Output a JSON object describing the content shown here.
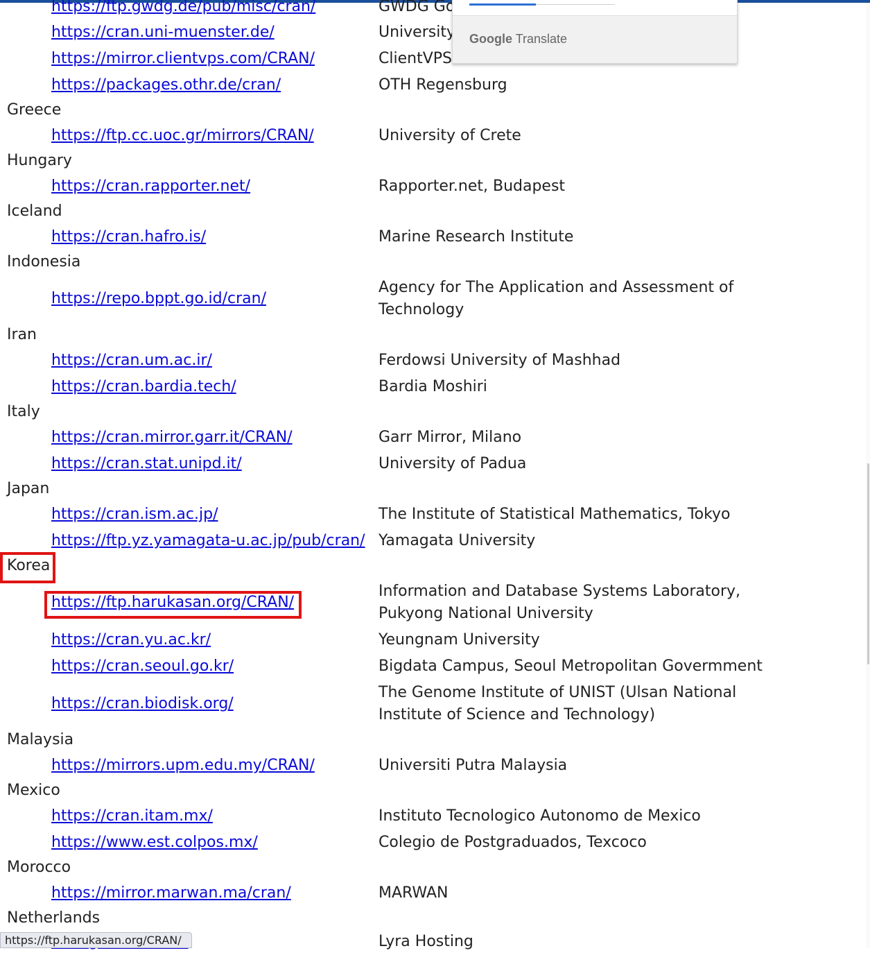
{
  "mirrors": [
    {
      "kind": "mirror",
      "url": "https://ftp.gwdg.de/pub/misc/cran/",
      "host": "GWDG Go"
    },
    {
      "kind": "mirror",
      "url": "https://cran.uni-muenster.de/",
      "host": "University"
    },
    {
      "kind": "mirror",
      "url": "https://mirror.clientvps.com/CRAN/",
      "host": "ClientVPS"
    },
    {
      "kind": "mirror",
      "url": "https://packages.othr.de/cran/",
      "host": "OTH Regensburg"
    },
    {
      "kind": "country",
      "name": "Greece"
    },
    {
      "kind": "mirror",
      "url": "https://ftp.cc.uoc.gr/mirrors/CRAN/",
      "host": "University of Crete"
    },
    {
      "kind": "country",
      "name": "Hungary"
    },
    {
      "kind": "mirror",
      "url": "https://cran.rapporter.net/",
      "host": "Rapporter.net, Budapest"
    },
    {
      "kind": "country",
      "name": "Iceland"
    },
    {
      "kind": "mirror",
      "url": "https://cran.hafro.is/",
      "host": "Marine Research Institute"
    },
    {
      "kind": "country",
      "name": "Indonesia"
    },
    {
      "kind": "mirror",
      "url": "https://repo.bppt.go.id/cran/",
      "host": "Agency for The Application and Assessment of Technology"
    },
    {
      "kind": "country",
      "name": "Iran"
    },
    {
      "kind": "mirror",
      "url": "https://cran.um.ac.ir/",
      "host": "Ferdowsi University of Mashhad"
    },
    {
      "kind": "mirror",
      "url": "https://cran.bardia.tech/",
      "host": "Bardia Moshiri"
    },
    {
      "kind": "country",
      "name": "Italy"
    },
    {
      "kind": "mirror",
      "url": "https://cran.mirror.garr.it/CRAN/",
      "host": "Garr Mirror, Milano"
    },
    {
      "kind": "mirror",
      "url": "https://cran.stat.unipd.it/",
      "host": "University of Padua"
    },
    {
      "kind": "country",
      "name": "Japan"
    },
    {
      "kind": "mirror",
      "url": "https://cran.ism.ac.jp/",
      "host": "The Institute of Statistical Mathematics, Tokyo"
    },
    {
      "kind": "mirror",
      "url": "https://ftp.yz.yamagata-u.ac.jp/pub/cran/",
      "host": "Yamagata University"
    },
    {
      "kind": "country",
      "name": "Korea"
    },
    {
      "kind": "mirror",
      "url": "https://ftp.harukasan.org/CRAN/",
      "host": "Information and Database Systems Laboratory, Pukyong National University"
    },
    {
      "kind": "mirror",
      "url": "https://cran.yu.ac.kr/",
      "host": "Yeungnam University"
    },
    {
      "kind": "mirror",
      "url": "https://cran.seoul.go.kr/",
      "host": "Bigdata Campus, Seoul Metropolitan Govermment"
    },
    {
      "kind": "mirror",
      "url": "https://cran.biodisk.org/",
      "host": "The Genome Institute of UNIST (Ulsan National Institute of Science and Technology)"
    },
    {
      "kind": "country",
      "name": "Malaysia"
    },
    {
      "kind": "mirror",
      "url": "https://mirrors.upm.edu.my/CRAN/",
      "host": "Universiti Putra Malaysia"
    },
    {
      "kind": "country",
      "name": "Mexico"
    },
    {
      "kind": "mirror",
      "url": "https://cran.itam.mx/",
      "host": "Instituto Tecnologico Autonomo de Mexico"
    },
    {
      "kind": "mirror",
      "url": "https://www.est.colpos.mx/",
      "host": "Colegio de Postgraduados, Texcoco"
    },
    {
      "kind": "country",
      "name": "Morocco"
    },
    {
      "kind": "mirror",
      "url": "https://mirror.marwan.ma/cran/",
      "host": "MARWAN"
    },
    {
      "kind": "country",
      "name": "Netherlands"
    },
    {
      "kind": "mirror",
      "url": "osting.com/CRAN/",
      "host": "Lyra Hosting"
    }
  ],
  "translate_popup": {
    "brand_google": "Google",
    "brand_translate": "Translate"
  },
  "status_bar": {
    "url": "https://ftp.harukasan.org/CRAN/"
  },
  "colors": {
    "link": "#0b0bd8",
    "highlight": "#e01414",
    "top_accent": "#1a4f9b"
  }
}
